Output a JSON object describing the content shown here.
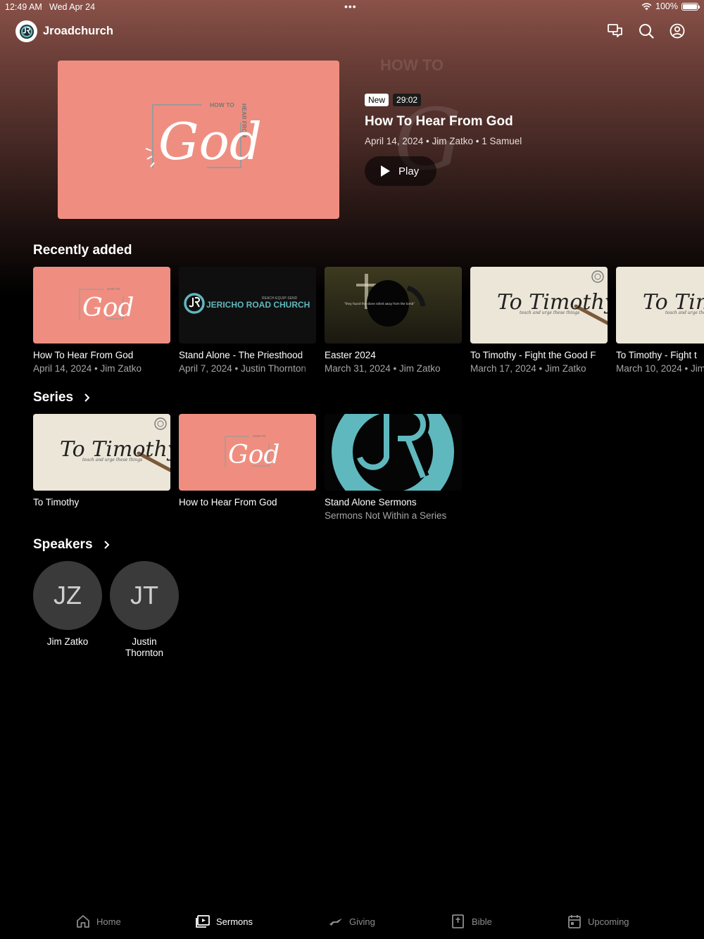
{
  "status": {
    "time": "12:49 AM",
    "date": "Wed Apr 24",
    "battery": "100%",
    "dots": "•••"
  },
  "app": {
    "title": "Jroadchurch"
  },
  "featured": {
    "badge_new": "New",
    "duration": "29:02",
    "title": "How To Hear From God",
    "meta": "April 14, 2024 • Jim Zatko • 1 Samuel",
    "play_label": "Play",
    "art": {
      "how_to": "HOW TO",
      "hear_from": "HEAR FROM",
      "god": "God"
    }
  },
  "recently_added": {
    "title": "Recently added",
    "items": [
      {
        "title": "How To Hear From God",
        "sub": "April 14, 2024 • Jim Zatko"
      },
      {
        "title": "Stand Alone - The Priesthood",
        "sub": "April 7, 2024 • Justin Thornton"
      },
      {
        "title": "Easter 2024",
        "sub": "March 31, 2024 • Jim Zatko"
      },
      {
        "title": "To Timothy - Fight the Good F",
        "sub": "March 17, 2024 • Jim Zatko"
      },
      {
        "title": "To Timothy - Fight t",
        "sub": "March 10, 2024 • Jim"
      }
    ]
  },
  "thumb_text": {
    "jericho": "JERICHO ROAD CHURCH",
    "jericho_tag": "REACH·EQUIP·SEND",
    "easter_quote": "\"they found the stone rolled away from the tomb\"",
    "timothy": "To Timothy",
    "timothy_sub": "teach and urge these things"
  },
  "series": {
    "title": "Series",
    "items": [
      {
        "title": "To Timothy",
        "sub": ""
      },
      {
        "title": "How to Hear From God",
        "sub": ""
      },
      {
        "title": "Stand Alone Sermons",
        "sub": "Sermons Not Within a Series"
      }
    ]
  },
  "speakers": {
    "title": "Speakers",
    "items": [
      {
        "initials": "JZ",
        "name": "Jim Zatko"
      },
      {
        "initials": "JT",
        "name": "Justin Thornton"
      }
    ]
  },
  "tabs": [
    {
      "label": "Home",
      "icon": "home-icon"
    },
    {
      "label": "Sermons",
      "icon": "sermons-icon"
    },
    {
      "label": "Giving",
      "icon": "giving-icon"
    },
    {
      "label": "Bible",
      "icon": "bible-icon"
    },
    {
      "label": "Upcoming",
      "icon": "calendar-icon"
    }
  ],
  "colors": {
    "accent": "#ffffff",
    "jr_teal": "#5fb8bd",
    "god_pink": "#ef8e80",
    "inactive_tab": "#8c8c8c"
  }
}
